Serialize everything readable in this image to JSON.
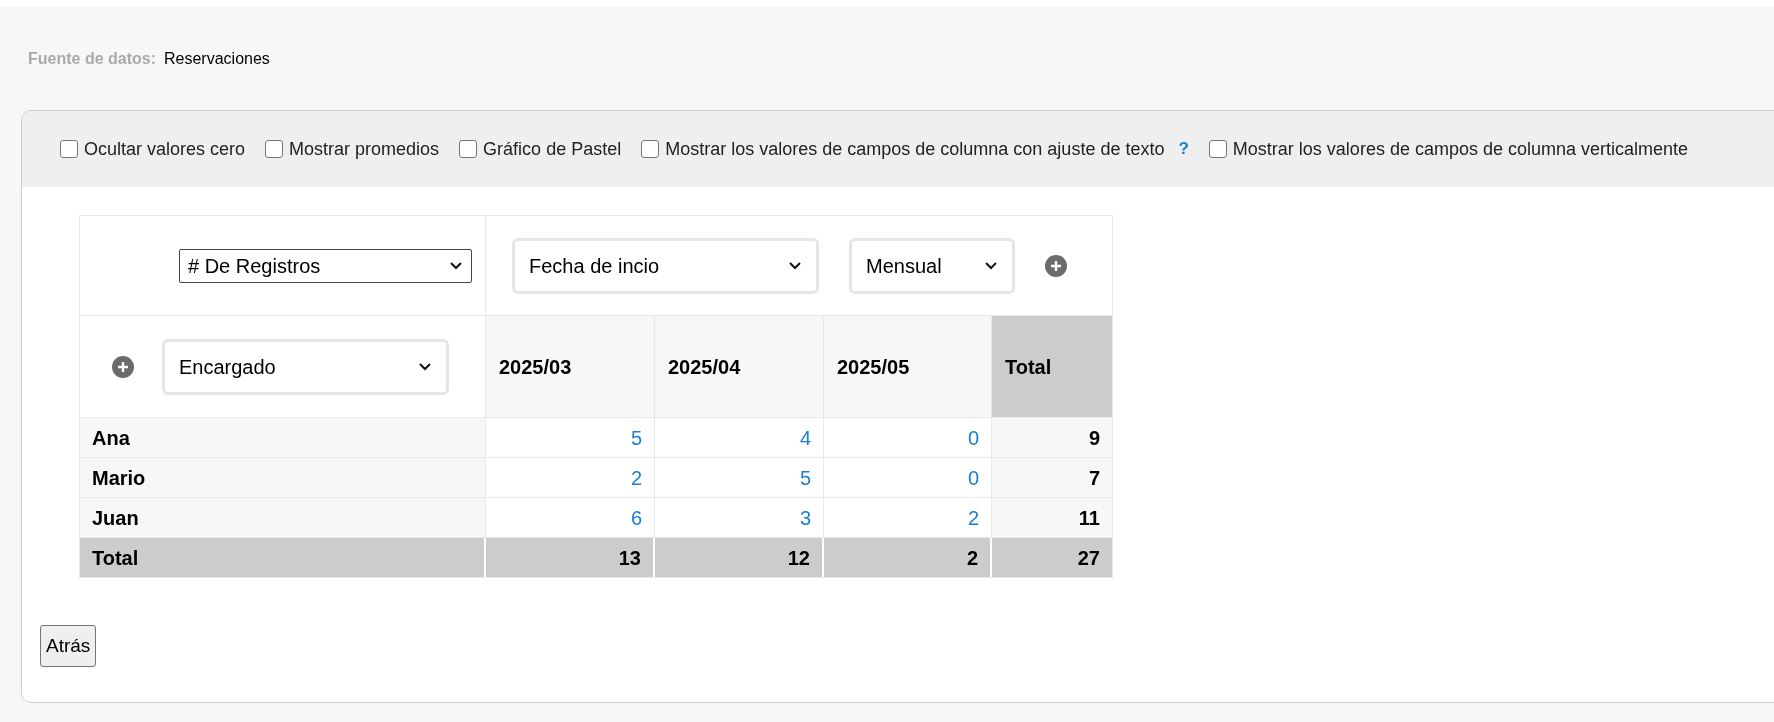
{
  "data_source": {
    "label": "Fuente de datos:",
    "value": "Reservaciones"
  },
  "options": [
    {
      "label": "Ocultar valores cero",
      "checked": false
    },
    {
      "label": "Mostrar promedios",
      "checked": false
    },
    {
      "label": "Gráfico de Pastel",
      "checked": false
    },
    {
      "label": "Mostrar los valores de campos de columna con ajuste de texto",
      "checked": false,
      "help": "?"
    },
    {
      "label": "Mostrar los valores de campos de columna verticalmente",
      "checked": false
    }
  ],
  "pivot": {
    "value_field": "# De Registros",
    "column_field": "Fecha de incio",
    "interval": "Mensual",
    "row_field": "Encargado",
    "columns": [
      "2025/03",
      "2025/04",
      "2025/05"
    ],
    "total_label": "Total",
    "rows": [
      {
        "label": "Ana",
        "values": [
          "5",
          "4",
          "0"
        ],
        "total": "9"
      },
      {
        "label": "Mario",
        "values": [
          "2",
          "5",
          "0"
        ],
        "total": "7"
      },
      {
        "label": "Juan",
        "values": [
          "6",
          "3",
          "2"
        ],
        "total": "11"
      }
    ],
    "totals": {
      "label": "Total",
      "values": [
        "13",
        "12",
        "2"
      ],
      "total": "27"
    }
  },
  "back_button": "Atrás"
}
